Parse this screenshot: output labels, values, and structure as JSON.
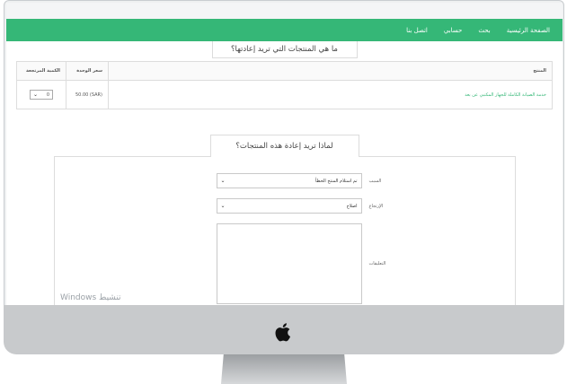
{
  "nav": {
    "items": [
      "الصفحة الرئيسية",
      "بحث",
      "حسابي",
      "اتصل بنا"
    ]
  },
  "products_section": {
    "heading": "ما هي المنتجات التي تريد إعادتها؟",
    "columns": {
      "product": "المنتج",
      "unit_price": "سعر الوحدة",
      "returned_qty": "الكمية المرتجعة"
    },
    "rows": [
      {
        "product": "خدمة الصيانة الكاملة للجهاز المكتبي عن بعد",
        "unit_price": "(SAR) 50.00",
        "qty": "0"
      }
    ]
  },
  "reason_section": {
    "heading": "لماذا تريد إعادة هذه المنتجات؟",
    "reason_label": "السبب",
    "reason_value": "تم استلام المنتج الخطأ",
    "refund_label": "الإرتجاع",
    "refund_value": "اصلاح",
    "notes_label": "التعليقات"
  },
  "watermark": "تنشيط Windows"
}
